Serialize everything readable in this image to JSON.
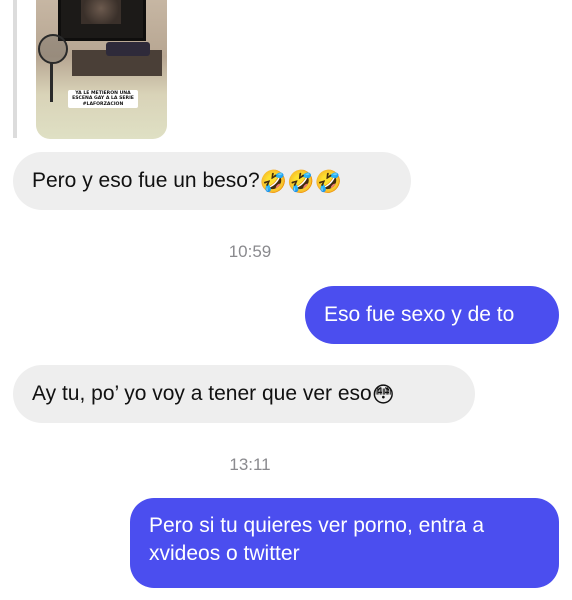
{
  "story_reply": {
    "caption_lines": [
      "YA LE METIERON UNA",
      "ESCENA GAY A LA SERIE",
      "#LAFORZACION"
    ]
  },
  "messages": [
    {
      "direction": "incoming",
      "text": "Pero y eso fue un beso?",
      "emoji": "🤣🤣🤣"
    },
    {
      "type": "timestamp",
      "text": "10:59"
    },
    {
      "direction": "outgoing",
      "text": "Eso fue sexo y de to"
    },
    {
      "direction": "incoming",
      "text": "Ay tu, po’ yo voy a tener que ver eso",
      "emoji": "😳"
    },
    {
      "type": "timestamp",
      "text": "13:11"
    },
    {
      "direction": "outgoing",
      "text": "Pero si tu quieres ver porno, entra a xvideos o twitter"
    }
  ],
  "icons": {
    "laughing": "rolling-on-floor-laughing-emoji",
    "flushed": "flushed-face-emoji"
  },
  "colors": {
    "incoming_bubble": "#eeeeee",
    "outgoing_bubble": "#4b4eef",
    "timestamp": "#8a8a8e"
  }
}
